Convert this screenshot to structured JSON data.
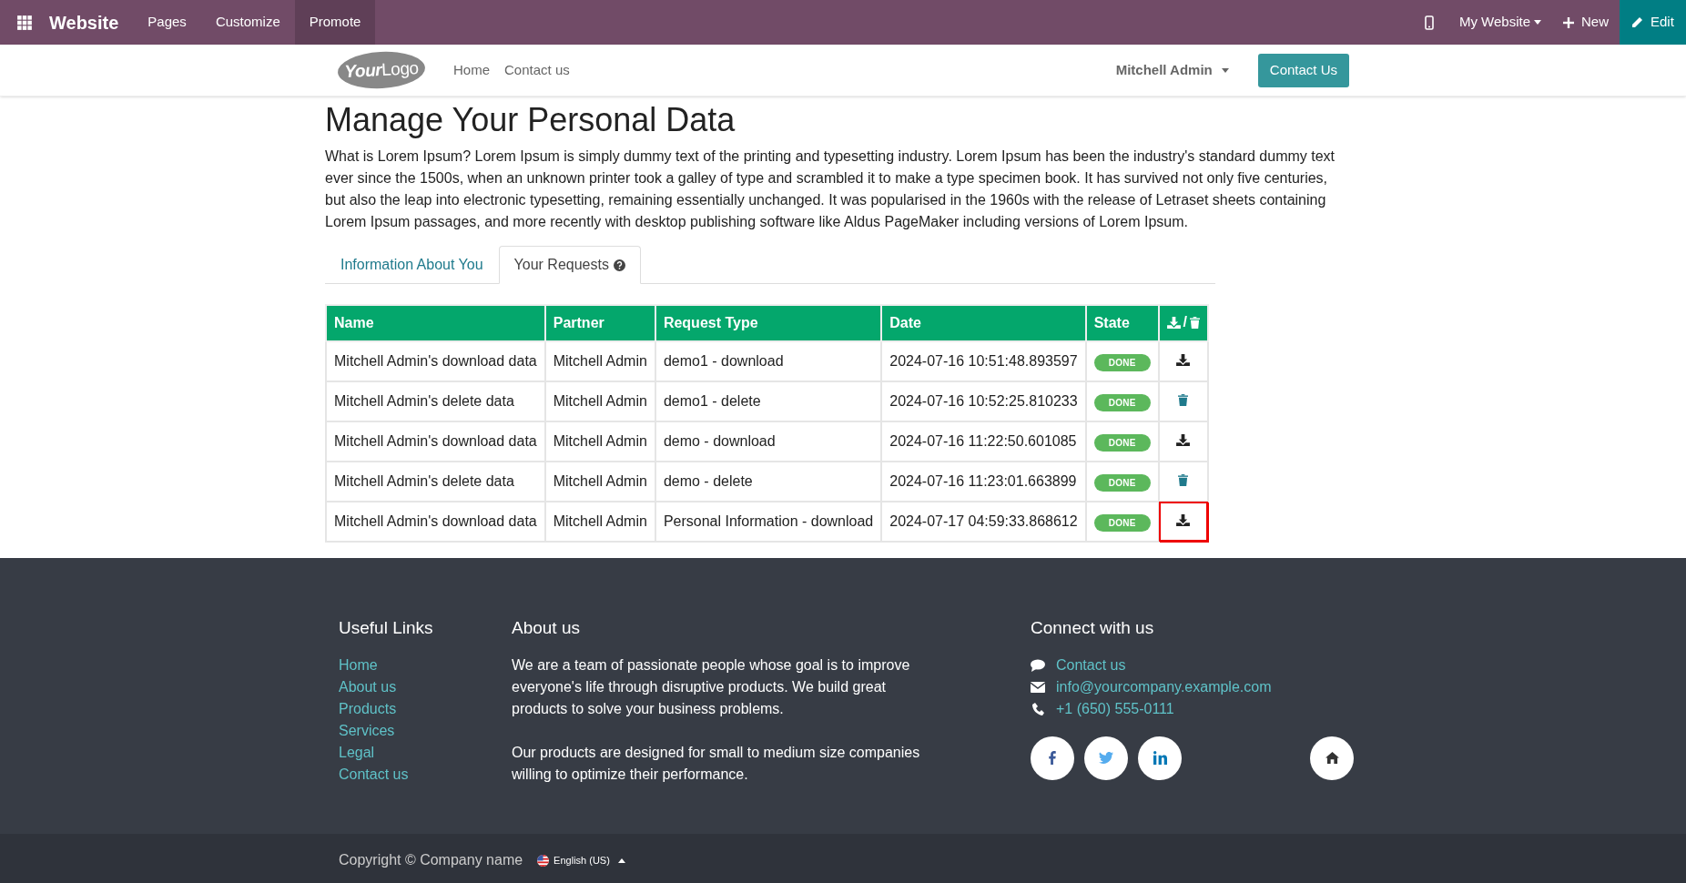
{
  "topbar": {
    "app": "Website",
    "menus": [
      {
        "label": "Pages",
        "selected": false
      },
      {
        "label": "Customize",
        "selected": false
      },
      {
        "label": "Promote",
        "selected": true
      }
    ],
    "site": "My Website",
    "new": "New",
    "edit": "Edit"
  },
  "header": {
    "logo_bold": "Your",
    "logo_light": "Logo",
    "nav": [
      "Home",
      "Contact us"
    ],
    "user": "Mitchell Admin",
    "cta": "Contact Us"
  },
  "page": {
    "title": "Manage Your Personal Data",
    "intro": "What is Lorem Ipsum? Lorem Ipsum is simply dummy text of the printing and typesetting industry. Lorem Ipsum has been the industry's standard dummy text ever since the 1500s, when an unknown printer took a galley of type and scrambled it to make a type specimen book. It has survived not only five centuries, but also the leap into electronic typesetting, remaining essentially unchanged. It was popularised in the 1960s with the release of Letraset sheets containing Lorem Ipsum passages, and more recently with desktop publishing software like Aldus PageMaker including versions of Lorem Ipsum.",
    "tabs": [
      {
        "label": "Information About You",
        "selected": false,
        "help": false
      },
      {
        "label": "Your Requests",
        "selected": true,
        "help": true
      }
    ]
  },
  "table": {
    "columns": [
      "Name",
      "Partner",
      "Request Type",
      "Date",
      "State"
    ],
    "action_separator": "/",
    "rows": [
      {
        "name": "Mitchell Admin's download data",
        "partner": "Mitchell Admin",
        "type": "demo1 - download",
        "date": "2024-07-16 10:51:48.893597",
        "state": "DONE",
        "kind": "download",
        "highlighted": false
      },
      {
        "name": "Mitchell Admin's delete data",
        "partner": "Mitchell Admin",
        "type": "demo1 - delete",
        "date": "2024-07-16 10:52:25.810233",
        "state": "DONE",
        "kind": "delete",
        "highlighted": false
      },
      {
        "name": "Mitchell Admin's download data",
        "partner": "Mitchell Admin",
        "type": "demo - download",
        "date": "2024-07-16 11:22:50.601085",
        "state": "DONE",
        "kind": "download",
        "highlighted": false
      },
      {
        "name": "Mitchell Admin's delete data",
        "partner": "Mitchell Admin",
        "type": "demo - delete",
        "date": "2024-07-16 11:23:01.663899",
        "state": "DONE",
        "kind": "delete",
        "highlighted": false
      },
      {
        "name": "Mitchell Admin's download data",
        "partner": "Mitchell Admin",
        "type": "Personal Information - download",
        "date": "2024-07-17 04:59:33.868612",
        "state": "DONE",
        "kind": "download",
        "highlighted": true
      }
    ]
  },
  "footer": {
    "links_title": "Useful Links",
    "links": [
      "Home",
      "About us",
      "Products",
      "Services",
      "Legal",
      "Contact us"
    ],
    "about_title": "About us",
    "about": [
      "We are a team of passionate people whose goal is to improve everyone's life through disruptive products. We build great products to solve your business problems.",
      "Our products are designed for small to medium size companies willing to optimize their performance."
    ],
    "connect_title": "Connect with us",
    "contacts": [
      {
        "kind": "chat",
        "text": "Contact us"
      },
      {
        "kind": "mail",
        "text": "info@yourcompany.example.com"
      },
      {
        "kind": "phone",
        "text": "+1 (650) 555-0111"
      }
    ],
    "copyright": "Copyright © Company name",
    "language": "English (US)"
  }
}
